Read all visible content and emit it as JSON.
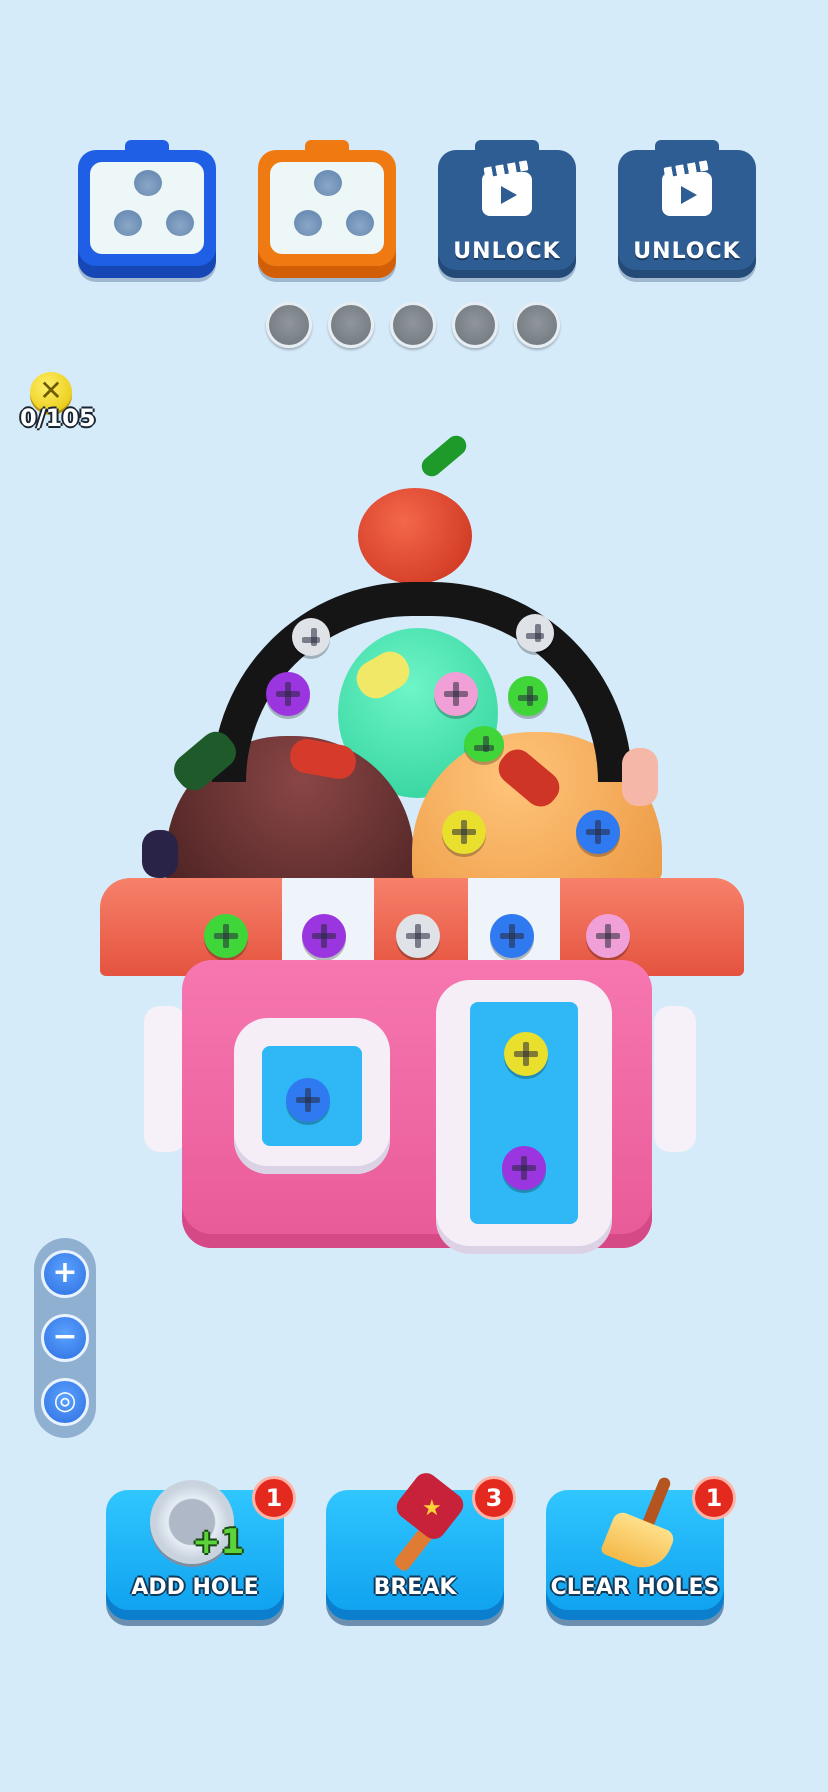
{
  "top_boxes": [
    {
      "color": "blue",
      "holes": 3,
      "locked": false
    },
    {
      "color": "orange",
      "holes": 3,
      "locked": false
    },
    {
      "locked": true,
      "label": "UNLOCK",
      "icon": "video-clapper-icon"
    },
    {
      "locked": true,
      "label": "UNLOCK",
      "icon": "video-clapper-icon"
    }
  ],
  "progress_dots": 5,
  "screw_counter": {
    "icon": "screw-icon",
    "value": "0/105"
  },
  "zoom_controls": [
    {
      "name": "zoom-in",
      "glyph": "+"
    },
    {
      "name": "zoom-out",
      "glyph": "−"
    },
    {
      "name": "recenter",
      "glyph": "◎"
    }
  ],
  "boosters": [
    {
      "name": "add-hole",
      "label": "ADD HOLE",
      "count": "1",
      "icon_text": "+1",
      "icon": "hole-icon"
    },
    {
      "name": "break",
      "label": "BREAK",
      "count": "3",
      "icon": "hammer-icon"
    },
    {
      "name": "clear-holes",
      "label": "CLEAR HOLES",
      "count": "1",
      "icon": "broom-icon"
    }
  ],
  "colors": {
    "background": "#d6ebfa",
    "box_blue": "#1f5fe6",
    "box_orange": "#f07a12",
    "locked_box": "#2e5d93",
    "booster": "#1ab2f7",
    "badge": "#e4291f"
  }
}
